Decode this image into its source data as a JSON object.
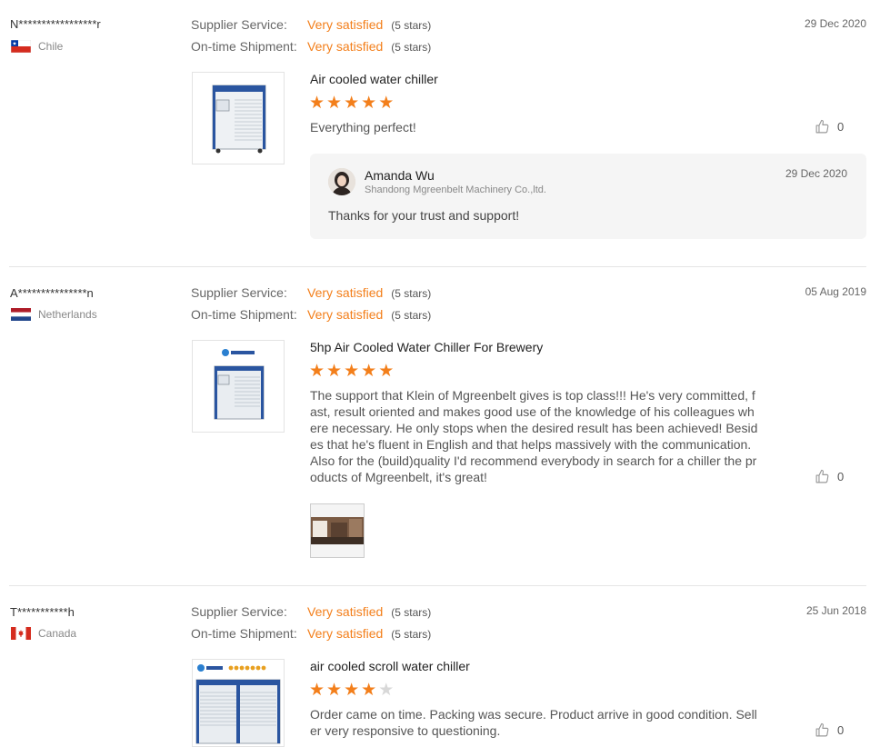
{
  "reviews": [
    {
      "buyer": "N*****************r",
      "country": "Chile",
      "supplier_label": "Supplier Service:",
      "supplier_value": "Very satisfied",
      "supplier_stars": "(5 stars)",
      "shipment_label": "On-time Shipment:",
      "shipment_value": "Very satisfied",
      "shipment_stars": "(5 stars)",
      "date": "29 Dec 2020",
      "product": "Air cooled water chiller",
      "rating": 5,
      "comment": "Everything perfect!",
      "likes": "0",
      "reply": {
        "name": "Amanda Wu",
        "company": "Shandong Mgreenbelt Machinery Co.,ltd.",
        "date": "29 Dec 2020",
        "text": "Thanks for your trust and support!"
      }
    },
    {
      "buyer": "A***************n",
      "country": "Netherlands",
      "supplier_label": "Supplier Service:",
      "supplier_value": "Very satisfied",
      "supplier_stars": "(5 stars)",
      "shipment_label": "On-time Shipment:",
      "shipment_value": "Very satisfied",
      "shipment_stars": "(5 stars)",
      "date": "05 Aug 2019",
      "product": "5hp Air Cooled Water Chiller For Brewery",
      "rating": 5,
      "comment": "The support that Klein of Mgreenbelt gives is top class!!! He's very committed, fast, result oriented and makes good use of the knowledge of his colleagues where necessary. He only stops when the desired result has been achieved! Besides that he's fluent in English and that helps massively with the communication. Also for the (build)quality I'd recommend everybody in search for a chiller the products of Mgreenbelt, it's great!",
      "likes": "0"
    },
    {
      "buyer": "T***********h",
      "country": "Canada",
      "supplier_label": "Supplier Service:",
      "supplier_value": "Very satisfied",
      "supplier_stars": "(5 stars)",
      "shipment_label": "On-time Shipment:",
      "shipment_value": "Very satisfied",
      "shipment_stars": "(5 stars)",
      "date": "25 Jun 2018",
      "product": "air cooled scroll water chiller",
      "rating": 4,
      "comment": "Order came on time. Packing was secure. Product arrive in good condition. Seller very responsive to questioning.",
      "likes": "0"
    }
  ],
  "colors": {
    "accent": "#f37f1b",
    "star_off": "#d8d8d8"
  },
  "icons": {
    "like": "thumbs-up-icon",
    "star": "star-icon"
  }
}
